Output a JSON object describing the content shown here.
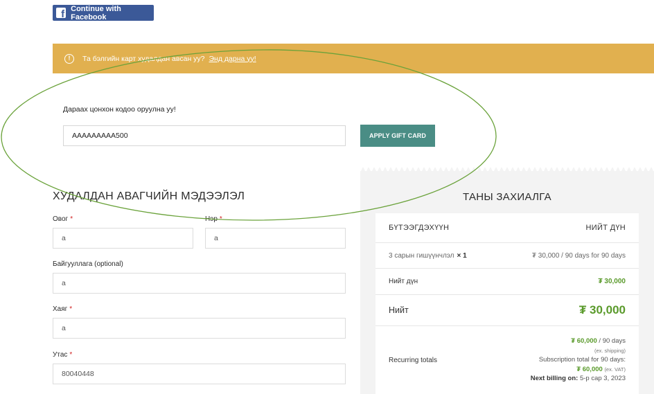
{
  "facebook": {
    "label": "Continue with Facebook",
    "icon": "facebook-icon"
  },
  "notice": {
    "text": "Та бэлгийн карт худалдан авсан уу?",
    "link": "Энд дарна уу!",
    "icon": "info-icon",
    "color": "#e1b04f"
  },
  "gift_card": {
    "label": "Дараах цонхон кодоо оруулна уу!",
    "value": "AAAAAAAAA500",
    "button": "APPLY GIFT CARD",
    "button_color": "#4a8d85"
  },
  "billing": {
    "title": "ХУДАЛДАН АВАГЧИЙН МЭДЭЭЛЭЛ",
    "last_name_label": "Овог",
    "last_name_value": "а",
    "first_name_label": "Нэр",
    "first_name_value": "а",
    "company_label": "Байгууллага (optional)",
    "company_value": "а",
    "address_label": "Хаяг",
    "address_value": "а",
    "phone_label": "Утас",
    "phone_value": "80040448",
    "required_mark": "*"
  },
  "order": {
    "title": "ТАНЫ ЗАХИАЛГА",
    "col_product": "БҮТЭЭГДЭХҮҮН",
    "col_total": "НИЙТ ДҮН",
    "product_name": "3 сарын гишүүнчлэл",
    "product_qty": "× 1",
    "product_price": "₮ 30,000 / 90 days for 90 days",
    "subtotal_label": "Нийт дүн",
    "subtotal_value": "₮ 30,000",
    "total_label": "Нийт",
    "total_value": "₮ 30,000",
    "recurring_label": "Recurring totals",
    "recurring_amount": "₮ 60,000",
    "recurring_period": " / 90 days",
    "recurring_shipping_note": "(ex. shipping)",
    "subscription_total_label": "Subscription total for 90 days:",
    "subscription_total_value": "₮ 60,000",
    "subscription_vat_note": "(ex. VAT)",
    "next_billing_label": "Next billing on:",
    "next_billing_value": " 5-р сар 3, 2023",
    "accent_color": "#5a9a2b"
  },
  "annotation": {
    "color": "#6aa23a"
  }
}
